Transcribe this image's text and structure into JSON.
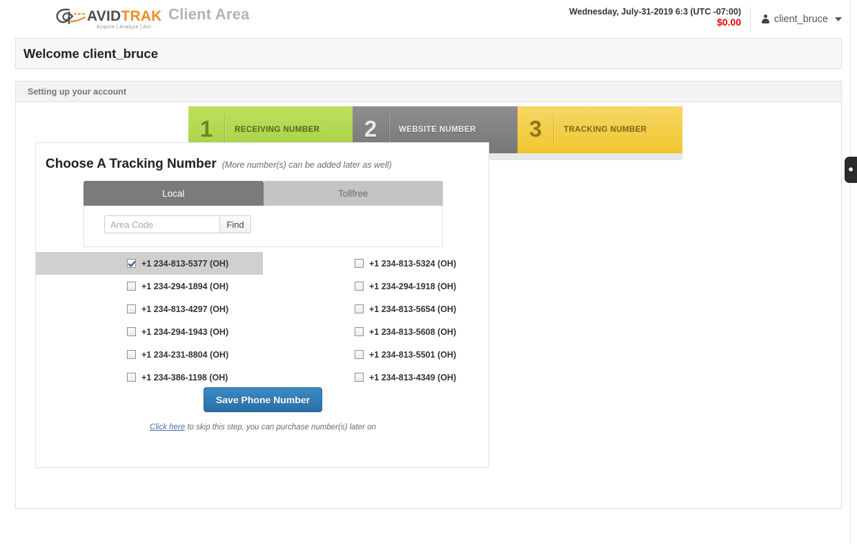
{
  "header": {
    "logo": {
      "part1": "AVID",
      "part2": "TRAK",
      "tagline": "Acquire  |  Analyze  |  Act",
      "icon": "avidtrak-logo-icon"
    },
    "app_title": "Client Area",
    "datetime": "Wednesday, July-31-2019 6:3 (UTC -07:00)",
    "balance": "$0.00",
    "user": "client_bruce",
    "user_icon": "person-icon",
    "caret_icon": "chevron-down-icon",
    "colors": {
      "balance": "#e00000",
      "brand_orange": "#ef8c22",
      "brand_gray": "#4d4d4d"
    }
  },
  "welcome": {
    "title": "Welcome client_bruce"
  },
  "setup": {
    "section_title": "Setting up your account",
    "steps": [
      {
        "number": "1",
        "label": "RECEIVING NUMBER",
        "color": "#a9cf47",
        "state": "complete"
      },
      {
        "number": "2",
        "label": "WEBSITE NUMBER",
        "color": "#777777",
        "state": "complete"
      },
      {
        "number": "3",
        "label": "TRACKING NUMBER",
        "color": "#f0c62f",
        "state": "current"
      }
    ],
    "progress": {
      "percent": 50,
      "fill_color": "#2f77b5",
      "track_color": "#e8e8e8"
    }
  },
  "card": {
    "title": "Choose A Tracking Number",
    "subtitle": "(More number(s) can be added later as well)",
    "tabs": [
      {
        "label": "Local",
        "active": true
      },
      {
        "label": "Tollfree",
        "active": false
      }
    ],
    "search": {
      "placeholder": "Area Code",
      "value": "",
      "find_label": "Find"
    },
    "numbers_left": [
      {
        "label": "+1 234-813-5377 (OH)",
        "checked": true,
        "highlighted": true
      },
      {
        "label": "+1 234-294-1894 (OH)",
        "checked": false,
        "highlighted": false
      },
      {
        "label": "+1 234-813-4297 (OH)",
        "checked": false,
        "highlighted": false
      },
      {
        "label": "+1 234-294-1943 (OH)",
        "checked": false,
        "highlighted": false
      },
      {
        "label": "+1 234-231-8804 (OH)",
        "checked": false,
        "highlighted": false
      },
      {
        "label": "+1 234-386-1198 (OH)",
        "checked": false,
        "highlighted": false
      }
    ],
    "numbers_right": [
      {
        "label": "+1 234-813-5324 (OH)",
        "checked": false,
        "highlighted": false
      },
      {
        "label": "+1 234-294-1918 (OH)",
        "checked": false,
        "highlighted": false
      },
      {
        "label": "+1 234-813-5654 (OH)",
        "checked": false,
        "highlighted": false
      },
      {
        "label": "+1 234-813-5608 (OH)",
        "checked": false,
        "highlighted": false
      },
      {
        "label": "+1 234-813-5501 (OH)",
        "checked": false,
        "highlighted": false
      },
      {
        "label": "+1 234-813-4349 (OH)",
        "checked": false,
        "highlighted": false
      }
    ],
    "save_label": "Save Phone Number",
    "skip": {
      "link_text": "Click here",
      "rest_text": " to skip this step, you can purchase number(s) later on"
    }
  },
  "edge_widget": {
    "glyph": "●",
    "name": "feedback-tab"
  }
}
